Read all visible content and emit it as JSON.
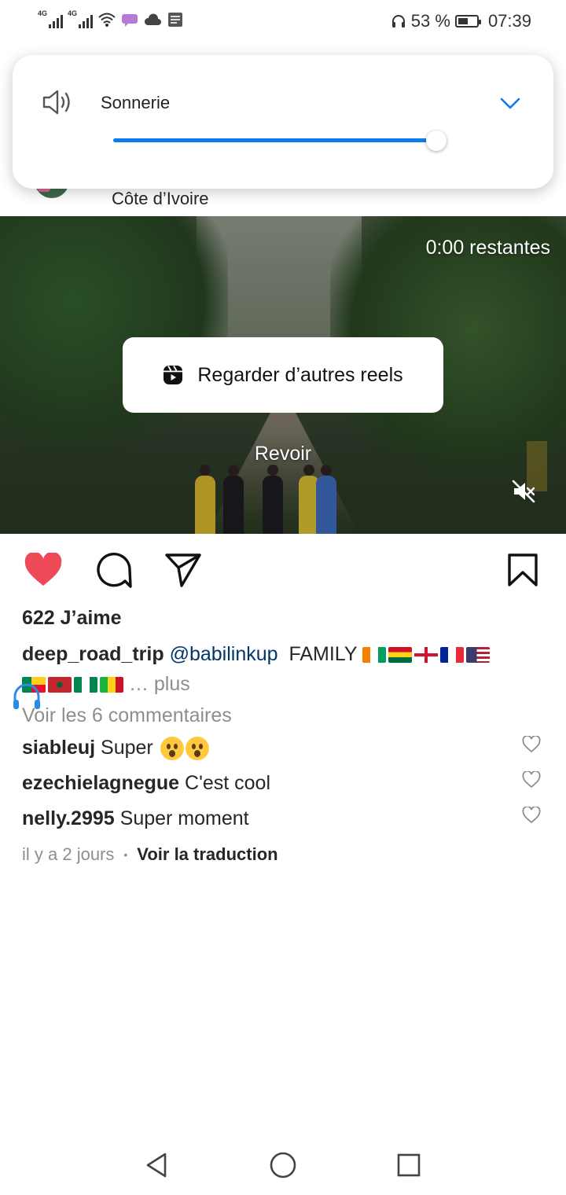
{
  "status_bar": {
    "signal1_label": "4G",
    "signal2_label": "4G",
    "battery_percent": "53 %",
    "battery_level": 0.53,
    "time": "07:39"
  },
  "volume": {
    "label": "Sonnerie",
    "level": 0.97,
    "accent_color": "#0a7cf0"
  },
  "post": {
    "location": "Côte d’Ivoire"
  },
  "video": {
    "time_remaining": "0:00 restantes",
    "reels_button_label": "Regarder d’autres reels",
    "replay_label": "Revoir"
  },
  "actions": {
    "like_color": "#ed4956",
    "liked": true
  },
  "likes_text": "622 J’aime",
  "caption": {
    "username": "deep_road_trip",
    "mention": "@babilinkup",
    "text": "FAMILY",
    "more": "… plus"
  },
  "view_comments": "Voir les 6 commentaires",
  "comments": [
    {
      "username": "siableuj",
      "text": "Super"
    },
    {
      "username": "ezechielagnegue",
      "text": "C'est cool"
    },
    {
      "username": "nelly.2995",
      "text": "Super moment"
    }
  ],
  "meta": {
    "time_ago": "il y a 2 jours",
    "separator": "•",
    "translate": "Voir la traduction"
  }
}
